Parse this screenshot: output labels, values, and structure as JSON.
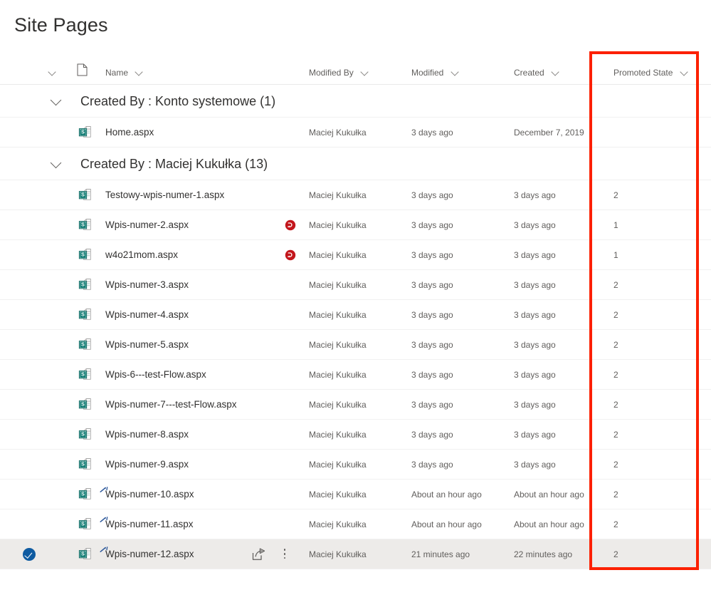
{
  "page": {
    "title": "Site Pages"
  },
  "columns": {
    "select_chevron_icon": "chevron-down-icon",
    "file_type_icon": "file-icon",
    "name": "Name",
    "modified_by": "Modified By",
    "modified": "Modified",
    "created": "Created",
    "promoted_state": "Promoted State",
    "sort_chevron_icon": "chevron-down-icon"
  },
  "annotation": {
    "target_column": "Promoted State",
    "color": "#fc2000"
  },
  "groups": [
    {
      "id": "group-konto-systemowe",
      "label": "Created By : Konto systemowe (1)",
      "collapse_icon": "chevron-down-icon",
      "expanded": true,
      "rows": [
        {
          "name": "Home.aspx",
          "icon": "sharepoint-page-icon",
          "is_new": false,
          "flag_icon": "",
          "modified_by": "Maciej Kukułka",
          "modified": "3 days ago",
          "created": "December 7, 2019",
          "promoted_state": "",
          "selected": false
        }
      ]
    },
    {
      "id": "group-maciej-kukulka",
      "label": "Created By : Maciej Kukułka (13)",
      "collapse_icon": "chevron-down-icon",
      "expanded": true,
      "rows": [
        {
          "name": "Testowy-wpis-numer-1.aspx",
          "icon": "sharepoint-page-icon",
          "is_new": false,
          "flag_icon": "",
          "modified_by": "Maciej Kukułka",
          "modified": "3 days ago",
          "created": "3 days ago",
          "promoted_state": "2",
          "selected": false
        },
        {
          "name": "Wpis-numer-2.aspx",
          "icon": "sharepoint-page-icon",
          "is_new": false,
          "flag_icon": "red-status-icon",
          "modified_by": "Maciej Kukułka",
          "modified": "3 days ago",
          "created": "3 days ago",
          "promoted_state": "1",
          "selected": false
        },
        {
          "name": "w4o21mom.aspx",
          "icon": "sharepoint-page-icon",
          "is_new": false,
          "flag_icon": "red-status-icon",
          "modified_by": "Maciej Kukułka",
          "modified": "3 days ago",
          "created": "3 days ago",
          "promoted_state": "1",
          "selected": false
        },
        {
          "name": "Wpis-numer-3.aspx",
          "icon": "sharepoint-page-icon",
          "is_new": false,
          "flag_icon": "",
          "modified_by": "Maciej Kukułka",
          "modified": "3 days ago",
          "created": "3 days ago",
          "promoted_state": "2",
          "selected": false
        },
        {
          "name": "Wpis-numer-4.aspx",
          "icon": "sharepoint-page-icon",
          "is_new": false,
          "flag_icon": "",
          "modified_by": "Maciej Kukułka",
          "modified": "3 days ago",
          "created": "3 days ago",
          "promoted_state": "2",
          "selected": false
        },
        {
          "name": "Wpis-numer-5.aspx",
          "icon": "sharepoint-page-icon",
          "is_new": false,
          "flag_icon": "",
          "modified_by": "Maciej Kukułka",
          "modified": "3 days ago",
          "created": "3 days ago",
          "promoted_state": "2",
          "selected": false
        },
        {
          "name": "Wpis-6---test-Flow.aspx",
          "icon": "sharepoint-page-icon",
          "is_new": false,
          "flag_icon": "",
          "modified_by": "Maciej Kukułka",
          "modified": "3 days ago",
          "created": "3 days ago",
          "promoted_state": "2",
          "selected": false
        },
        {
          "name": "Wpis-numer-7---test-Flow.aspx",
          "icon": "sharepoint-page-icon",
          "is_new": false,
          "flag_icon": "",
          "modified_by": "Maciej Kukułka",
          "modified": "3 days ago",
          "created": "3 days ago",
          "promoted_state": "2",
          "selected": false
        },
        {
          "name": "Wpis-numer-8.aspx",
          "icon": "sharepoint-page-icon",
          "is_new": false,
          "flag_icon": "",
          "modified_by": "Maciej Kukułka",
          "modified": "3 days ago",
          "created": "3 days ago",
          "promoted_state": "2",
          "selected": false
        },
        {
          "name": "Wpis-numer-9.aspx",
          "icon": "sharepoint-page-icon",
          "is_new": false,
          "flag_icon": "",
          "modified_by": "Maciej Kukułka",
          "modified": "3 days ago",
          "created": "3 days ago",
          "promoted_state": "2",
          "selected": false
        },
        {
          "name": "Wpis-numer-10.aspx",
          "icon": "sharepoint-page-icon",
          "is_new": true,
          "flag_icon": "",
          "modified_by": "Maciej Kukułka",
          "modified": "About an hour ago",
          "created": "About an hour ago",
          "promoted_state": "2",
          "selected": false
        },
        {
          "name": "Wpis-numer-11.aspx",
          "icon": "sharepoint-page-icon",
          "is_new": true,
          "flag_icon": "",
          "modified_by": "Maciej Kukułka",
          "modified": "About an hour ago",
          "created": "About an hour ago",
          "promoted_state": "2",
          "selected": false
        },
        {
          "name": "Wpis-numer-12.aspx",
          "icon": "sharepoint-page-icon",
          "is_new": true,
          "flag_icon": "",
          "modified_by": "Maciej Kukułka",
          "modified": "21 minutes ago",
          "created": "22 minutes ago",
          "promoted_state": "2",
          "selected": true,
          "share_icon": "share-icon",
          "more_icon": "more-actions-icon",
          "checkbox_icon": "checkmark-circle-icon"
        }
      ]
    }
  ]
}
